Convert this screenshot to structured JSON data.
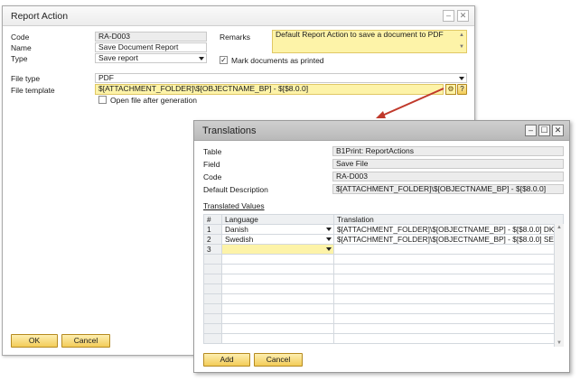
{
  "report_action": {
    "title": "Report Action",
    "code_label": "Code",
    "code_value": "RA-D003",
    "name_label": "Name",
    "name_value": "Save Document Report",
    "type_label": "Type",
    "type_value": "Save report",
    "remarks_label": "Remarks",
    "remarks_value": "Default Report Action to save a document to PDF",
    "mark_printed_label": "Mark documents as printed",
    "file_type_label": "File type",
    "file_type_value": "PDF",
    "file_template_label": "File template",
    "file_template_value": "$[ATTACHMENT_FOLDER]\\$[OBJECTNAME_BP] - $[$8.0.0]",
    "help_label": "?",
    "open_after_label": "Open file after generation",
    "ok_label": "OK",
    "cancel_label": "Cancel"
  },
  "translations": {
    "title": "Translations",
    "table_label": "Table",
    "table_value": "B1Print: ReportActions",
    "field_label": "Field",
    "field_value": "Save File",
    "code_label": "Code",
    "code_value": "RA-D003",
    "default_desc_label": "Default Description",
    "default_desc_value": "$[ATTACHMENT_FOLDER]\\$[OBJECTNAME_BP] - $[$8.0.0]",
    "translated_values_label": "Translated Values",
    "columns": {
      "num": "#",
      "language": "Language",
      "translation": "Translation"
    },
    "rows": [
      {
        "num": "1",
        "language": "Danish",
        "translation": "$[ATTACHMENT_FOLDER]\\$[OBJECTNAME_BP] - $[$8.0.0] DK"
      },
      {
        "num": "2",
        "language": "Swedish",
        "translation": "$[ATTACHMENT_FOLDER]\\$[OBJECTNAME_BP] - $[$8.0.0] SE"
      },
      {
        "num": "3",
        "language": "",
        "translation": ""
      }
    ],
    "add_label": "Add",
    "cancel_label": "Cancel"
  },
  "colors": {
    "accent_yellow": "#fdf3a8",
    "button_gold": "#f3cc58",
    "arrow_red": "#c0392b",
    "titlebar_gray": "#b9b9b9"
  }
}
